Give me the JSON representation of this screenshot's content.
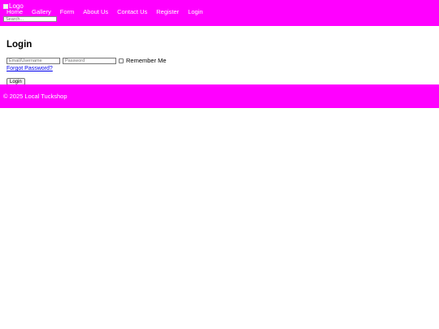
{
  "header": {
    "logo_alt": "Logo",
    "nav": [
      "Home",
      "Gallery",
      "Form",
      "About Us",
      "Contact Us",
      "Register",
      "Login"
    ],
    "search_placeholder": "Search..."
  },
  "main": {
    "title": "Login",
    "email_placeholder": "Email/Username",
    "password_placeholder": "Password",
    "remember_label": "Remember Me",
    "forgot_label": "Forgot Password?",
    "login_button": "Login"
  },
  "footer": {
    "text": "© 2025 Local Tuckshop"
  },
  "colors": {
    "header_bg": "#ff00ff",
    "footer_bg": "#ff00ff",
    "link": "#0000ee"
  }
}
